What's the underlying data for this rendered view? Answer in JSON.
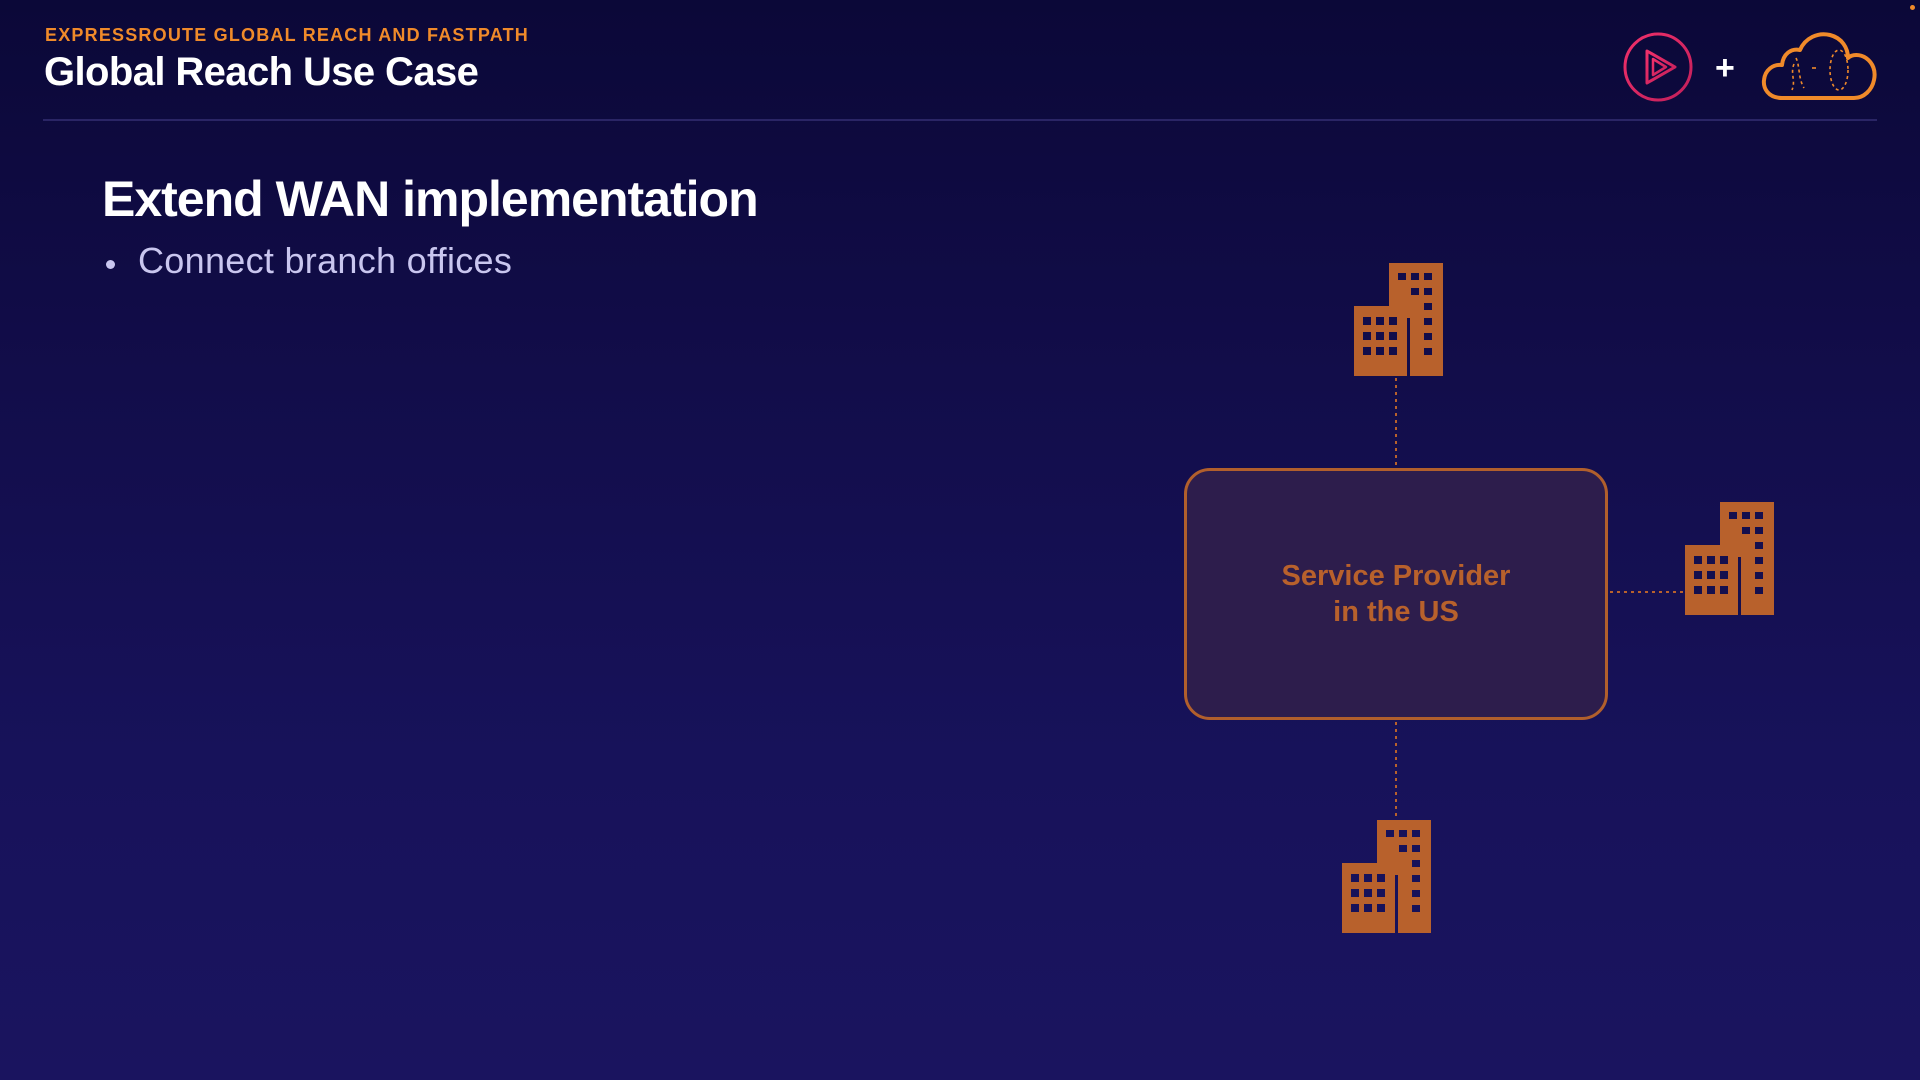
{
  "header": {
    "eyebrow": "EXPRESSROUTE GLOBAL REACH AND FASTPATH",
    "title": "Global Reach Use Case",
    "plus": "+"
  },
  "content": {
    "heading": "Extend WAN implementation",
    "bullets": [
      "Connect branch offices"
    ]
  },
  "diagram": {
    "provider_label": "Service Provider\nin the US",
    "nodes": [
      {
        "name": "branch-office-top",
        "icon": "office-building-icon"
      },
      {
        "name": "branch-office-right",
        "icon": "office-building-icon"
      },
      {
        "name": "branch-office-bottom",
        "icon": "office-building-icon"
      }
    ],
    "connector_style": "dotted"
  },
  "colors": {
    "accent": "#f08a2a",
    "building": "#b8612c",
    "box_border": "#b15f2c",
    "box_fill": "#2d1d4c",
    "bg_top": "#0b0838",
    "bg_bottom": "#1a145f",
    "brand_play": "#e8216a"
  },
  "icons": {
    "brand": "play-logo-icon",
    "cloud": "cloud-logo-icon"
  }
}
